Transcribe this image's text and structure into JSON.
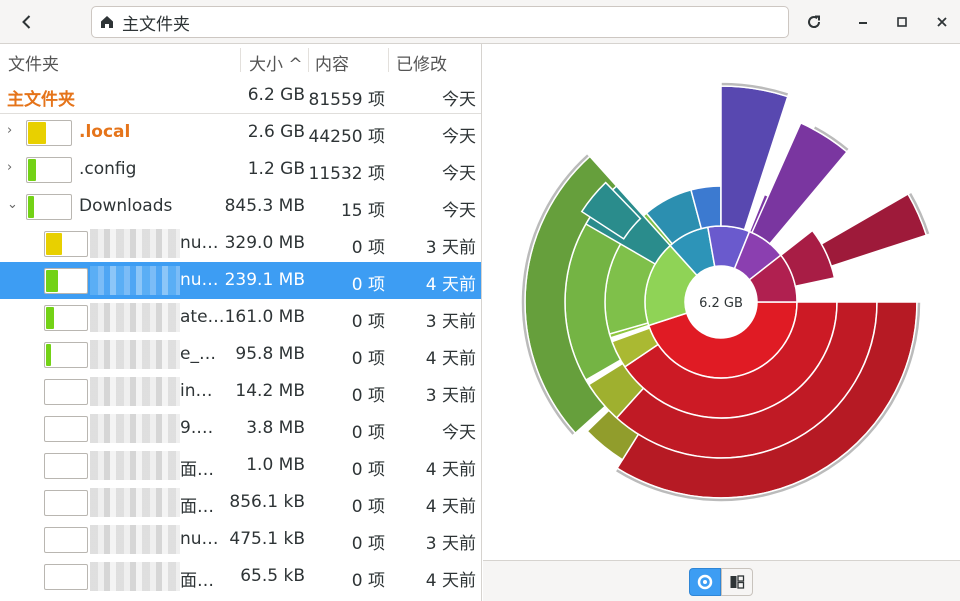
{
  "header": {
    "path_label": "主文件夹",
    "icons": {
      "back": "chevron-left-icon",
      "home": "home-icon",
      "refresh": "refresh-icon",
      "minimize": "minimize-icon",
      "maximize": "maximize-icon",
      "close": "close-icon"
    }
  },
  "columns": {
    "name": "文件夹",
    "size": "大小 ^",
    "contents": "内容",
    "modified": "已修改"
  },
  "root": {
    "name": "主文件夹",
    "size": "6.2 GB",
    "contents": "81559 项",
    "modified": "今天"
  },
  "rows": [
    {
      "name": ".local",
      "size": "2.6 GB",
      "contents": "44250 项",
      "modified": "今天",
      "expander": "›",
      "fill": 0.42,
      "color": "#e8d000",
      "highlight": true
    },
    {
      "name": ".config",
      "size": "1.2 GB",
      "contents": "11532 项",
      "modified": "今天",
      "expander": "›",
      "fill": 0.19,
      "color": "#73d216"
    },
    {
      "name": "Downloads",
      "size": "845.3 MB",
      "contents": "15 项",
      "modified": "今天",
      "expander": "⌄",
      "fill": 0.14,
      "color": "#73d216"
    },
    {
      "name": "nu…",
      "size": "329.0 MB",
      "contents": "0 项",
      "modified": "3 天前",
      "fill": 0.39,
      "color": "#e8d000",
      "child": true
    },
    {
      "name": "nu…",
      "size": "239.1 MB",
      "contents": "0 项",
      "modified": "4 天前",
      "fill": 0.28,
      "color": "#73d216",
      "child": true,
      "selected": true
    },
    {
      "name": "ate…",
      "size": "161.0 MB",
      "contents": "0 项",
      "modified": "3 天前",
      "fill": 0.19,
      "color": "#73d216",
      "child": true
    },
    {
      "name": "e_…",
      "size": "95.8 MB",
      "contents": "0 项",
      "modified": "4 天前",
      "fill": 0.11,
      "color": "#73d216",
      "child": true
    },
    {
      "name": "in…",
      "size": "14.2 MB",
      "contents": "0 项",
      "modified": "3 天前",
      "fill": 0.0,
      "color": "#73d216",
      "child": true
    },
    {
      "name": "9.…",
      "size": "3.8 MB",
      "contents": "0 项",
      "modified": "今天",
      "fill": 0.0,
      "color": "#73d216",
      "child": true
    },
    {
      "name": "面…",
      "size": "1.0 MB",
      "contents": "0 项",
      "modified": "4 天前",
      "fill": 0.0,
      "color": "#73d216",
      "child": true
    },
    {
      "name": "面…",
      "size": "856.1 kB",
      "contents": "0 项",
      "modified": "4 天前",
      "fill": 0.0,
      "color": "#73d216",
      "child": true
    },
    {
      "name": "nu…",
      "size": "475.1 kB",
      "contents": "0 项",
      "modified": "3 天前",
      "fill": 0.0,
      "color": "#73d216",
      "child": true
    },
    {
      "name": "面…",
      "size": "65.5 kB",
      "contents": "0 项",
      "modified": "4 天前",
      "fill": 0.0,
      "color": "#73d216",
      "child": true
    }
  ],
  "chart": {
    "center_label": "6.2 GB"
  },
  "bottom": {
    "ring_view": "ring-chart-icon",
    "tree_view": "treemap-icon"
  }
}
